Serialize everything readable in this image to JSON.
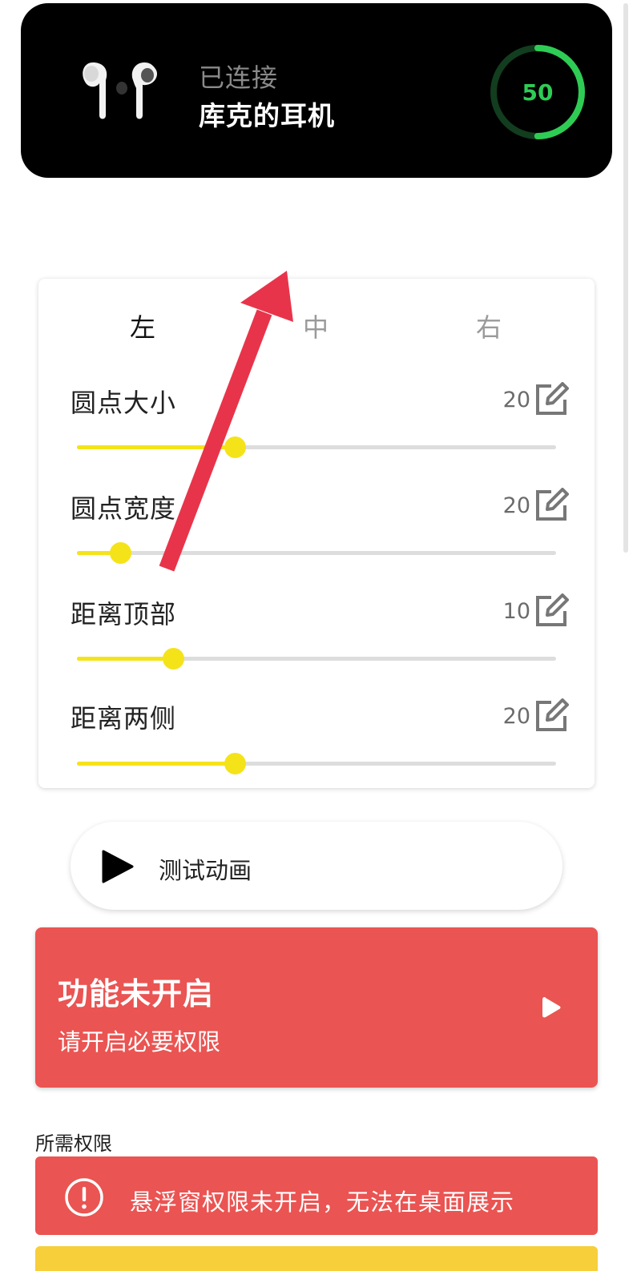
{
  "header": {
    "status": "已连接",
    "device_name": "库克的耳机",
    "battery": "50",
    "battery_level": 0.5
  },
  "tabs": [
    {
      "label": "左",
      "active": true
    },
    {
      "label": "中",
      "active": false
    },
    {
      "label": "右",
      "active": false
    }
  ],
  "settings": [
    {
      "label": "圆点大小",
      "value": "20",
      "slider_fraction": 0.33
    },
    {
      "label": "圆点宽度",
      "value": "20",
      "slider_fraction": 0.09
    },
    {
      "label": "距离顶部",
      "value": "10",
      "slider_fraction": 0.2
    },
    {
      "label": "距离两侧",
      "value": "20",
      "slider_fraction": 0.33
    }
  ],
  "test_button": {
    "label": "测试动画"
  },
  "feature": {
    "title": "功能未开启",
    "subtitle": "请开启必要权限"
  },
  "permissions": {
    "heading": "所需权限",
    "items": [
      {
        "text": "悬浮窗权限未开启，无法在桌面展示"
      }
    ]
  },
  "colors": {
    "accent_yellow": "#f5e31a",
    "alert_red": "#ea5452",
    "battery_green": "#2ecc55",
    "warning_yellow": "#f6cf3a"
  }
}
